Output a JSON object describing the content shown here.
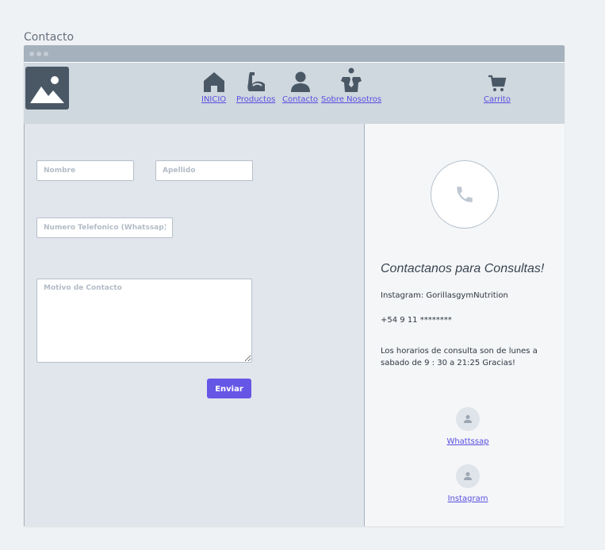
{
  "page": {
    "title": "Contacto"
  },
  "nav": {
    "items": [
      {
        "label": "INICIO",
        "icon": "home-icon"
      },
      {
        "label": "Productos",
        "icon": "flexed-arm-icon"
      },
      {
        "label": "Contacto",
        "icon": "user-icon"
      },
      {
        "label": "Sobre Nosotros",
        "icon": "person-tie-icon"
      }
    ],
    "cart": {
      "label": "Carrito",
      "icon": "cart-icon"
    }
  },
  "form": {
    "nombre_placeholder": "Nombre",
    "apellido_placeholder": "Apellido",
    "telefono_placeholder": "Numero Telefonico (Whatssap)",
    "motivo_placeholder": "Motivo de Contacto",
    "submit_label": "Enviar"
  },
  "info": {
    "heading": "Contactanos para Consultas!",
    "instagram": "Instagram: GorillasgymNutrition",
    "phone": "+54 9 11 ********",
    "hours": "Los horarios de consulta son de lunes a sabado de 9 : 30 a 21:25 Gracias!"
  },
  "social": [
    {
      "label": "Whattssap"
    },
    {
      "label": "Instagram"
    }
  ],
  "colors": {
    "accent": "#6556e6",
    "navbar": "#cfd7df",
    "titlebar": "#a5b1bd",
    "form_panel": "#e1e5ec"
  }
}
